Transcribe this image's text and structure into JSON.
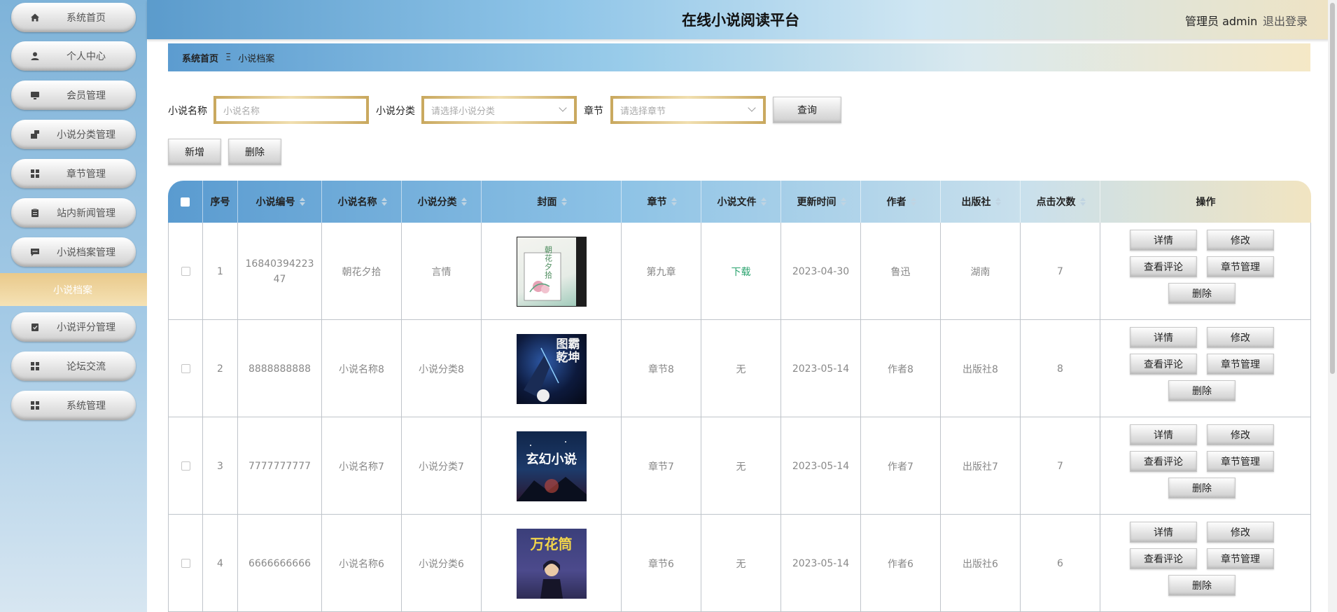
{
  "header": {
    "title": "在线小说阅读平台",
    "user": "管理员 admin",
    "logout": "退出登录"
  },
  "sidebar": {
    "items": [
      {
        "label": "系统首页",
        "icon": "home-icon"
      },
      {
        "label": "个人中心",
        "icon": "user-icon"
      },
      {
        "label": "会员管理",
        "icon": "monitor-icon"
      },
      {
        "label": "小说分类管理",
        "icon": "category-icon"
      },
      {
        "label": "章节管理",
        "icon": "grid-icon"
      },
      {
        "label": "站内新闻管理",
        "icon": "clipboard-icon"
      },
      {
        "label": "小说档案管理",
        "icon": "chat-icon"
      }
    ],
    "active_sub": "小说档案",
    "items_after": [
      {
        "label": "小说评分管理",
        "icon": "check-clipboard-icon"
      },
      {
        "label": "论坛交流",
        "icon": "grid-icon"
      },
      {
        "label": "系统管理",
        "icon": "grid-icon"
      }
    ]
  },
  "breadcrumb": {
    "home": "系统首页",
    "sep": "Ξ",
    "current": "小说档案"
  },
  "search": {
    "name_label": "小说名称",
    "name_placeholder": "小说名称",
    "category_label": "小说分类",
    "category_placeholder": "请选择小说分类",
    "chapter_label": "章节",
    "chapter_placeholder": "请选择章节",
    "query_button": "查询",
    "add_button": "新增",
    "delete_button": "删除"
  },
  "table": {
    "columns": [
      "序号",
      "小说编号",
      "小说名称",
      "小说分类",
      "封面",
      "章节",
      "小说文件",
      "更新时间",
      "作者",
      "出版社",
      "点击次数",
      "操作"
    ],
    "actions": {
      "detail": "详情",
      "edit": "修改",
      "comments": "查看评论",
      "chapters": "章节管理",
      "delete": "删除"
    },
    "rows": [
      {
        "index": "1",
        "code": "1684039422347",
        "name": "朝花夕拾",
        "category": "言情",
        "chapter": "第九章",
        "file": "下载",
        "updated": "2023-04-30",
        "author": "鲁迅",
        "publisher": "湖南",
        "clicks": "7",
        "cover_text": "朝花夕拾"
      },
      {
        "index": "2",
        "code": "8888888888",
        "name": "小说名称8",
        "category": "小说分类8",
        "chapter": "章节8",
        "file": "无",
        "updated": "2023-05-14",
        "author": "作者8",
        "publisher": "出版社8",
        "clicks": "8",
        "cover_text": "图霸乾坤"
      },
      {
        "index": "3",
        "code": "7777777777",
        "name": "小说名称7",
        "category": "小说分类7",
        "chapter": "章节7",
        "file": "无",
        "updated": "2023-05-14",
        "author": "作者7",
        "publisher": "出版社7",
        "clicks": "7",
        "cover_text": "玄幻小说"
      },
      {
        "index": "4",
        "code": "6666666666",
        "name": "小说名称6",
        "category": "小说分类6",
        "chapter": "章节6",
        "file": "无",
        "updated": "2023-05-14",
        "author": "作者6",
        "publisher": "出版社6",
        "clicks": "6",
        "cover_text": "万花筒"
      }
    ]
  },
  "colors": {
    "accent_gold": "#e9c98b",
    "header_blue": "#5b9bcc",
    "download_green": "#2aa36e"
  }
}
